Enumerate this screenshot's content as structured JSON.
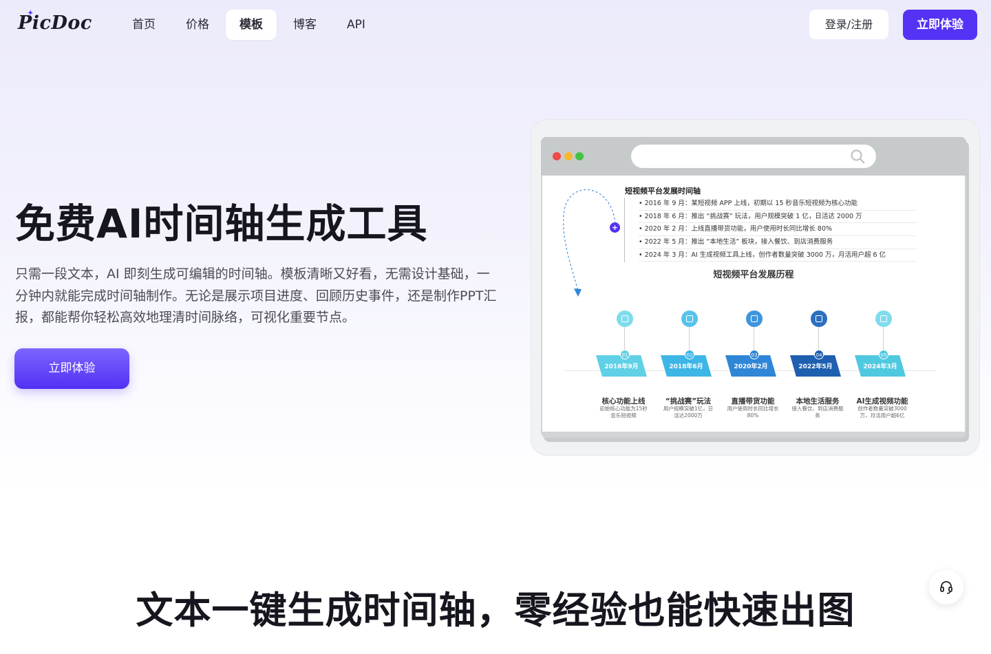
{
  "header": {
    "logo": "PicDoc",
    "nav": [
      {
        "label": "首页",
        "active": false
      },
      {
        "label": "价格",
        "active": false
      },
      {
        "label": "模板",
        "active": true
      },
      {
        "label": "博客",
        "active": false
      },
      {
        "label": "API",
        "active": false
      }
    ],
    "login_label": "登录/注册",
    "try_label": "立即体验"
  },
  "hero": {
    "title": "免费AI时间轴生成工具",
    "description": "只需一段文本，AI 即刻生成可编辑的时间轴。模板清晰又好看，无需设计基础，一分钟内就能完成时间轴制作。无论是展示项目进度、回顾历史事件，还是制作PPT汇报，都能帮你轻松高效地理清时间脉络，可视化重要节点。",
    "cta_label": "立即体验"
  },
  "preview": {
    "doc_heading": "短视频平台发展时间轴",
    "doc_lines": [
      "• 2016 年 9 月：某短视频 APP 上线，初期以 15 秒音乐短视频为核心功能",
      "• 2018 年 6 月：推出 “挑战赛” 玩法，用户规模突破 1 亿，日活达 2000 万",
      "• 2020 年 2 月：上线直播带货功能，用户使用时长同比增长 80%",
      "• 2022 年 5 月：推出 “本地生活” 板块，接入餐饮、到店消费服务",
      "• 2024 年 3 月：AI 生成视频工具上线，创作者数量突破 3000 万，月活用户超 6 亿"
    ],
    "timeline_title": "短视频平台发展历程",
    "nodes": [
      {
        "num": "01",
        "date": "2016年9月",
        "label": "核心功能上线",
        "desc": "初始核心功能为15秒音乐短视频",
        "color": "#5fd0e6"
      },
      {
        "num": "02",
        "date": "2018年6月",
        "label": "“挑战赛”玩法",
        "desc": "用户规模突破1亿，日活达2000万",
        "color": "#3db5e6"
      },
      {
        "num": "03",
        "date": "2020年2月",
        "label": "直播带货功能",
        "desc": "用户使用时长同比增长80%",
        "color": "#2f86d6"
      },
      {
        "num": "04",
        "date": "2022年5月",
        "label": "本地生活服务",
        "desc": "接入餐饮、到店消费服务",
        "color": "#1e5fb0"
      },
      {
        "num": "05",
        "date": "2024年3月",
        "label": "AI生成视频功能",
        "desc": "创作者数量突破3000万，月活用户超6亿",
        "color": "#4fc9e0"
      }
    ]
  },
  "section2": {
    "title": "文本一键生成时间轴，零经验也能快速出图"
  },
  "icons": {
    "search": "search-icon",
    "support": "headset-icon",
    "add": "plus-icon"
  }
}
